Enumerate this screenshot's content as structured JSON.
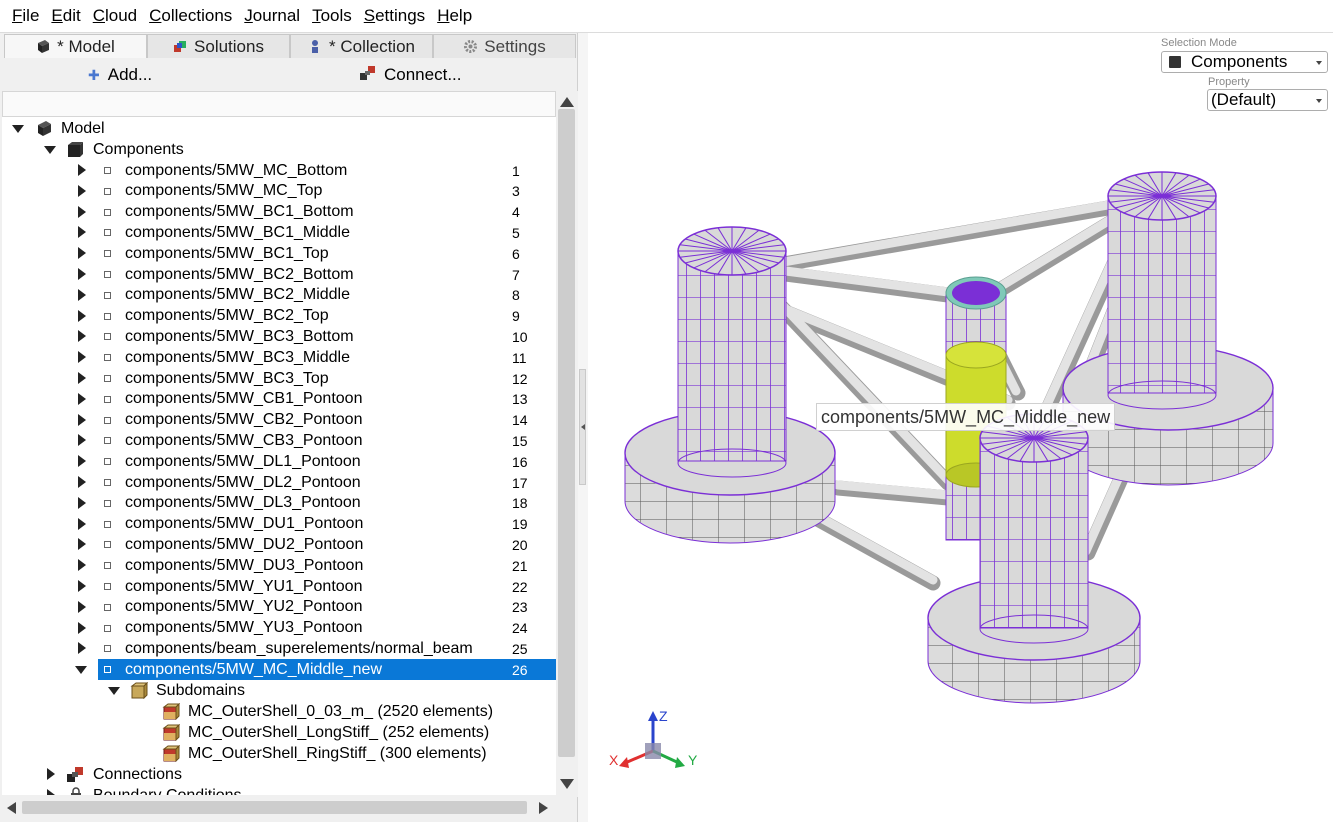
{
  "menu": [
    {
      "accel": "F",
      "rest": "ile"
    },
    {
      "accel": "E",
      "rest": "dit"
    },
    {
      "accel": "C",
      "rest": "loud"
    },
    {
      "accel": "C",
      "rest": "ollections"
    },
    {
      "accel": "J",
      "rest": "ournal"
    },
    {
      "accel": "T",
      "rest": "ools"
    },
    {
      "accel": "S",
      "rest": "ettings"
    },
    {
      "accel": "H",
      "rest": "elp"
    }
  ],
  "tabs": [
    {
      "label": "* Model",
      "icon": "model-icon",
      "active": true
    },
    {
      "label": "Solutions",
      "icon": "solutions-icon",
      "active": false
    },
    {
      "label": "* Collection",
      "icon": "collection-icon",
      "active": false
    },
    {
      "label": "Settings",
      "icon": "gear-icon",
      "active": false
    }
  ],
  "actions": {
    "add": "Add...",
    "connect": "Connect..."
  },
  "tree": {
    "root": "Model",
    "components": "Components",
    "items": [
      {
        "label": "components/5MW_MC_Bottom",
        "num": "1"
      },
      {
        "label": "components/5MW_MC_Top",
        "num": "3"
      },
      {
        "label": "components/5MW_BC1_Bottom",
        "num": "4"
      },
      {
        "label": "components/5MW_BC1_Middle",
        "num": "5"
      },
      {
        "label": "components/5MW_BC1_Top",
        "num": "6"
      },
      {
        "label": "components/5MW_BC2_Bottom",
        "num": "7"
      },
      {
        "label": "components/5MW_BC2_Middle",
        "num": "8"
      },
      {
        "label": "components/5MW_BC2_Top",
        "num": "9"
      },
      {
        "label": "components/5MW_BC3_Bottom",
        "num": "10"
      },
      {
        "label": "components/5MW_BC3_Middle",
        "num": "11"
      },
      {
        "label": "components/5MW_BC3_Top",
        "num": "12"
      },
      {
        "label": "components/5MW_CB1_Pontoon",
        "num": "13"
      },
      {
        "label": "components/5MW_CB2_Pontoon",
        "num": "14"
      },
      {
        "label": "components/5MW_CB3_Pontoon",
        "num": "15"
      },
      {
        "label": "components/5MW_DL1_Pontoon",
        "num": "16"
      },
      {
        "label": "components/5MW_DL2_Pontoon",
        "num": "17"
      },
      {
        "label": "components/5MW_DL3_Pontoon",
        "num": "18"
      },
      {
        "label": "components/5MW_DU1_Pontoon",
        "num": "19"
      },
      {
        "label": "components/5MW_DU2_Pontoon",
        "num": "20"
      },
      {
        "label": "components/5MW_DU3_Pontoon",
        "num": "21"
      },
      {
        "label": "components/5MW_YU1_Pontoon",
        "num": "22"
      },
      {
        "label": "components/5MW_YU2_Pontoon",
        "num": "23"
      },
      {
        "label": "components/5MW_YU3_Pontoon",
        "num": "24"
      },
      {
        "label": "components/beam_superelements/normal_beam",
        "num": "25"
      },
      {
        "label": "components/5MW_MC_Middle_new",
        "num": "26",
        "selected": true
      }
    ],
    "subdomains": "Subdomains",
    "subitems": [
      "MC_OuterShell_0_03_m_ (2520 elements)",
      "MC_OuterShell_LongStiff_ (252 elements)",
      "MC_OuterShell_RingStiff_ (300 elements)"
    ],
    "connections": "Connections",
    "boundary": "Boundary Conditions"
  },
  "viewport": {
    "selection_mode_label": "Selection Mode",
    "selection_mode_value": "Components",
    "property_label": "Property",
    "property_value": "(Default)",
    "tooltip": "components/5MW_MC_Middle_new",
    "axes": {
      "x": "X",
      "y": "Y",
      "z": "Z"
    }
  },
  "colors": {
    "selection": "#0a78d7",
    "mesh_lines": "#7b2fd6",
    "structure_face": "#d7d7d7",
    "highlight": "#c8d62a",
    "axis_x": "#e03030",
    "axis_y": "#22aa44",
    "axis_z": "#2a44cc"
  }
}
